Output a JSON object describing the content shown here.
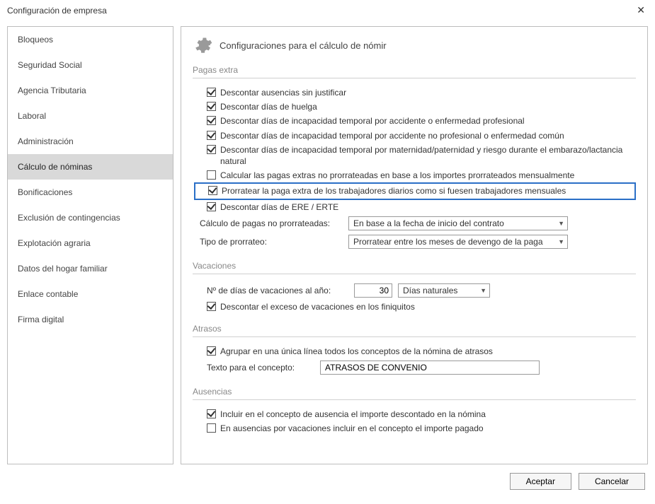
{
  "window": {
    "title": "Configuración de empresa",
    "close": "✕"
  },
  "sidebar": {
    "items": [
      {
        "label": "Bloqueos",
        "selected": false
      },
      {
        "label": "Seguridad Social",
        "selected": false
      },
      {
        "label": "Agencia Tributaria",
        "selected": false
      },
      {
        "label": "Laboral",
        "selected": false
      },
      {
        "label": "Administración",
        "selected": false
      },
      {
        "label": "Cálculo de nóminas",
        "selected": true
      },
      {
        "label": "Bonificaciones",
        "selected": false
      },
      {
        "label": "Exclusión de contingencias",
        "selected": false
      },
      {
        "label": "Explotación agraria",
        "selected": false
      },
      {
        "label": "Datos del hogar familiar",
        "selected": false
      },
      {
        "label": "Enlace contable",
        "selected": false
      },
      {
        "label": "Firma digital",
        "selected": false
      }
    ]
  },
  "main": {
    "header_title": "Configuraciones para el cálculo de nómir",
    "sections": {
      "pagas_extra": {
        "title": "Pagas extra",
        "checks": [
          {
            "label": "Descontar ausencias sin justificar",
            "checked": true
          },
          {
            "label": "Descontar días de huelga",
            "checked": true
          },
          {
            "label": "Descontar días de incapacidad temporal por accidente o enfermedad profesional",
            "checked": true
          },
          {
            "label": "Descontar días de incapacidad temporal por accidente no profesional o enfermedad común",
            "checked": true
          },
          {
            "label": "Descontar días de incapacidad temporal por maternidad/paternidad y riesgo durante el embarazo/lactancia natural",
            "checked": true
          },
          {
            "label": "Calcular las pagas extras no prorrateadas en base a los importes prorrateados mensualmente",
            "checked": false
          },
          {
            "label": "Prorratear la paga extra de los trabajadores diarios como si fuesen trabajadores mensuales",
            "checked": true,
            "highlight": true
          },
          {
            "label": "Descontar días de ERE / ERTE",
            "checked": true
          }
        ],
        "calc_label": "Cálculo de pagas no prorrateadas:",
        "calc_value": "En base a la fecha de inicio del contrato",
        "tipo_label": "Tipo de prorrateo:",
        "tipo_value": "Prorratear entre los meses de devengo de la paga"
      },
      "vacaciones": {
        "title": "Vacaciones",
        "dias_label": "Nº de días de vacaciones al año:",
        "dias_value": "30",
        "dias_unit": "Días naturales",
        "check1": {
          "label": "Descontar el exceso de vacaciones en los finiquitos",
          "checked": true
        }
      },
      "atrasos": {
        "title": "Atrasos",
        "check1": {
          "label": "Agrupar en una única línea todos los conceptos de la nómina de atrasos",
          "checked": true
        },
        "texto_label": "Texto para el concepto:",
        "texto_value": "ATRASOS DE CONVENIO"
      },
      "ausencias": {
        "title": "Ausencias",
        "check1": {
          "label": "Incluir en el concepto de ausencia el importe descontado en la nómina",
          "checked": true
        },
        "check2": {
          "label": "En ausencias por vacaciones incluir en el concepto el importe pagado",
          "checked": false
        }
      }
    }
  },
  "footer": {
    "accept": "Aceptar",
    "cancel": "Cancelar"
  }
}
